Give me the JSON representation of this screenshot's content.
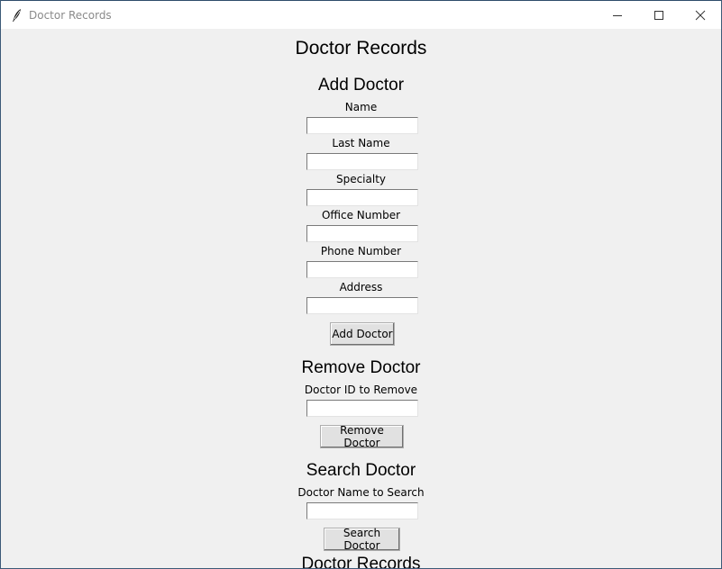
{
  "window": {
    "title": "Doctor Records",
    "icons": {
      "app": "feather-icon",
      "minimize": "minimize-icon",
      "maximize": "maximize-icon",
      "close": "close-icon"
    }
  },
  "main": {
    "title": "Doctor Records",
    "add_section": {
      "heading": "Add Doctor",
      "fields": {
        "name": {
          "label": "Name",
          "value": ""
        },
        "last_name": {
          "label": "Last Name",
          "value": ""
        },
        "specialty": {
          "label": "Specialty",
          "value": ""
        },
        "office_number": {
          "label": "Office Number",
          "value": ""
        },
        "phone_number": {
          "label": "Phone Number",
          "value": ""
        },
        "address": {
          "label": "Address",
          "value": ""
        }
      },
      "button": "Add Doctor"
    },
    "remove_section": {
      "heading": "Remove Doctor",
      "label": "Doctor ID to Remove",
      "value": "",
      "button": "Remove Doctor"
    },
    "search_section": {
      "heading": "Search Doctor",
      "label": "Doctor Name to Search",
      "value": "",
      "button": "Search Doctor"
    },
    "records_heading": "Doctor Records"
  },
  "colors": {
    "background": "#f0f0f0",
    "titlebar": "#ffffff",
    "window_border": "#3c5a78"
  }
}
